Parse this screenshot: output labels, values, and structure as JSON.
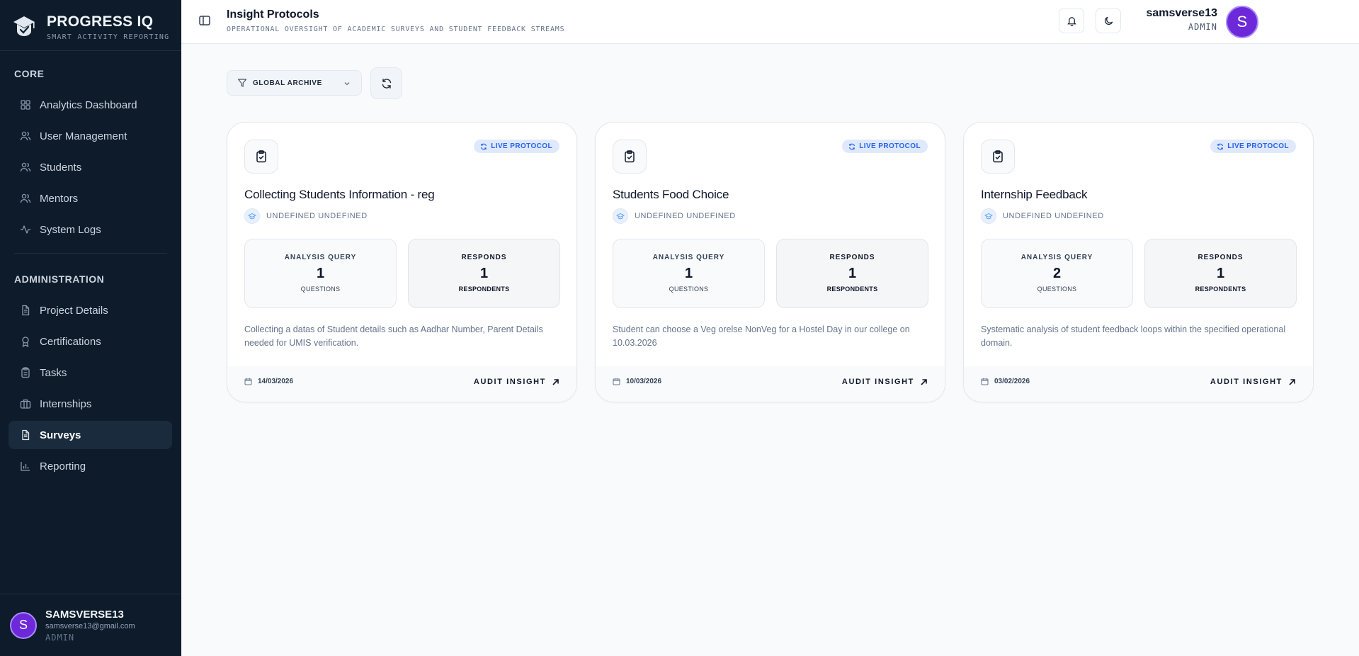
{
  "brand": {
    "title": "PROGRESS IQ",
    "subtitle": "SMART ACTIVITY REPORTING"
  },
  "sidebar": {
    "core_label": "CORE",
    "core_items": [
      {
        "label": "Analytics Dashboard",
        "icon": "grid-icon"
      },
      {
        "label": "User Management",
        "icon": "users-icon"
      },
      {
        "label": "Students",
        "icon": "users-icon"
      },
      {
        "label": "Mentors",
        "icon": "users-icon"
      },
      {
        "label": "System Logs",
        "icon": "activity-icon"
      }
    ],
    "admin_label": "ADMINISTRATION",
    "admin_items": [
      {
        "label": "Project Details",
        "icon": "file-icon"
      },
      {
        "label": "Certifications",
        "icon": "award-icon"
      },
      {
        "label": "Tasks",
        "icon": "clipboard-icon"
      },
      {
        "label": "Internships",
        "icon": "briefcase-icon"
      },
      {
        "label": "Surveys",
        "icon": "file-text-icon",
        "active": true
      },
      {
        "label": "Reporting",
        "icon": "bar-chart-icon"
      }
    ],
    "user": {
      "initial": "S",
      "name": "SAMSVERSE13",
      "email": "samsverse13@gmail.com",
      "role": "ADMIN"
    }
  },
  "header": {
    "title": "Insight Protocols",
    "subtitle": "OPERATIONAL OVERSIGHT OF ACADEMIC SURVEYS AND STUDENT FEEDBACK STREAMS",
    "user_name": "samsverse13",
    "user_role": "ADMIN",
    "avatar_initial": "S"
  },
  "filter": {
    "selected": "GLOBAL ARCHIVE"
  },
  "cards": [
    {
      "badge": "LIVE PROTOCOL",
      "title": "Collecting Students Information - reg",
      "subtitle": "UNDEFINED UNDEFINED",
      "stat_left": {
        "heading": "ANALYSIS QUERY",
        "value": "1",
        "caption": "QUESTIONS"
      },
      "stat_right": {
        "heading": "RESPONDS",
        "value": "1",
        "caption": "RESPONDENTS"
      },
      "description": "Collecting a datas of Student details such as Aadhar Number, Parent Details needed for UMIS verification.",
      "date": "14/03/2026",
      "action": "AUDIT INSIGHT"
    },
    {
      "badge": "LIVE PROTOCOL",
      "title": "Students Food Choice",
      "subtitle": "UNDEFINED UNDEFINED",
      "stat_left": {
        "heading": "ANALYSIS QUERY",
        "value": "1",
        "caption": "QUESTIONS"
      },
      "stat_right": {
        "heading": "RESPONDS",
        "value": "1",
        "caption": "RESPONDENTS"
      },
      "description": "Student can choose a Veg orelse NonVeg for a Hostel Day in our college on 10.03.2026",
      "date": "10/03/2026",
      "action": "AUDIT INSIGHT"
    },
    {
      "badge": "LIVE PROTOCOL",
      "title": "Internship Feedback",
      "subtitle": "UNDEFINED UNDEFINED",
      "stat_left": {
        "heading": "ANALYSIS QUERY",
        "value": "2",
        "caption": "QUESTIONS"
      },
      "stat_right": {
        "heading": "RESPONDS",
        "value": "1",
        "caption": "RESPONDENTS"
      },
      "description": "Systematic analysis of student feedback loops within the specified operational domain.",
      "date": "03/02/2026",
      "action": "AUDIT INSIGHT"
    }
  ]
}
